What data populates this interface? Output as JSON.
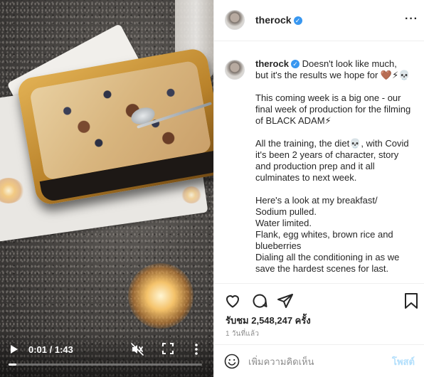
{
  "video": {
    "time_label": "0:01 / 1:43",
    "progress_fraction": 0.04,
    "icons": {
      "play": "play-icon",
      "mute": "muted-speaker-icon",
      "fullscreen": "fullscreen-icon",
      "more": "vertical-dots-icon"
    }
  },
  "header": {
    "username": "therock",
    "verified_mark": "✓",
    "more_label": "···"
  },
  "caption": {
    "username": "therock",
    "verified_mark": "✓",
    "lines": [
      "Doesn't look like much, but it's the results we hope for 🤎⚡💀",
      "",
      "This coming week is a big one - our final week of production for the filming of BLACK ADAM⚡",
      "",
      "All the training, the diet💀, with Covid it's been 2 years of character, story and production prep and it all culminates to next week.",
      "",
      "Here's a look at my breakfast/",
      "Sodium pulled.",
      "Water limited.",
      "Flank, egg whites, brown rice and blueberries",
      "Dialing all the conditioning in as we save the hardest scenes for last."
    ]
  },
  "actions": {
    "icons": [
      "heart-icon",
      "comment-icon",
      "share-icon",
      "save-icon"
    ],
    "views_label": "รับชม 2,548,247 ครั้ง",
    "time_ago": "1 วันที่แล้ว"
  },
  "comment": {
    "placeholder": "เพิ่มความคิดเห็น",
    "post_label": "โพสต์"
  },
  "colors": {
    "accent": "#3897f0",
    "post_disabled": "#b2dffc",
    "secondary_text": "#8e8e8e"
  }
}
